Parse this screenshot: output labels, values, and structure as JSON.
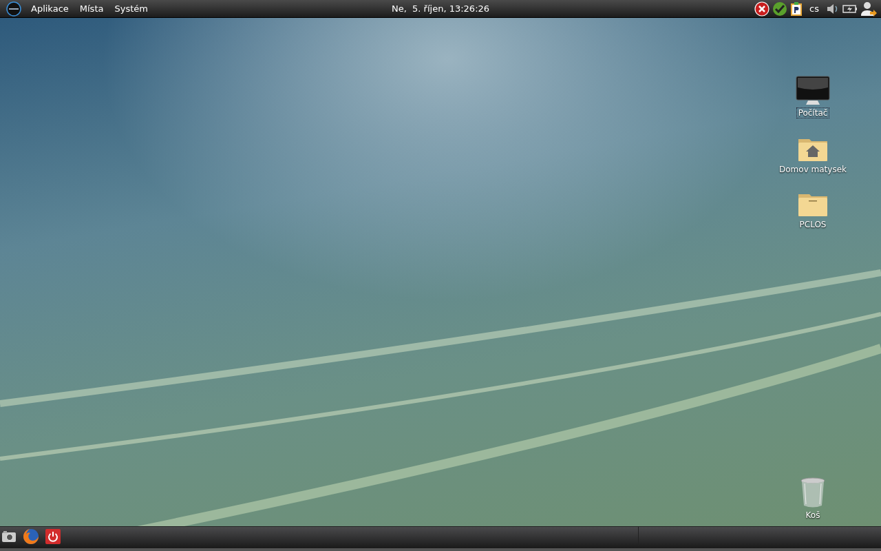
{
  "top_panel": {
    "menus": [
      "Aplikace",
      "Místa",
      "Systém"
    ],
    "clock": "Ne,  5. říjen, 13:26:26",
    "tray": [
      {
        "kind": "error"
      },
      {
        "kind": "check"
      },
      {
        "kind": "clipboard"
      },
      {
        "kind": "text",
        "label": "cs"
      },
      {
        "kind": "volume"
      },
      {
        "kind": "battery"
      },
      {
        "kind": "user"
      }
    ]
  },
  "desktop_icons": [
    {
      "kind": "computer",
      "label": "Počítač",
      "selected": true
    },
    {
      "kind": "home-folder",
      "label": "Domov matysek",
      "selected": false
    },
    {
      "kind": "folder",
      "label": "PCLOS",
      "selected": false
    },
    {
      "kind": "trash",
      "label": "Koš",
      "selected": false
    }
  ],
  "bottom_panel": {
    "launchers": [
      {
        "kind": "camera"
      },
      {
        "kind": "browser"
      },
      {
        "kind": "power"
      }
    ]
  }
}
